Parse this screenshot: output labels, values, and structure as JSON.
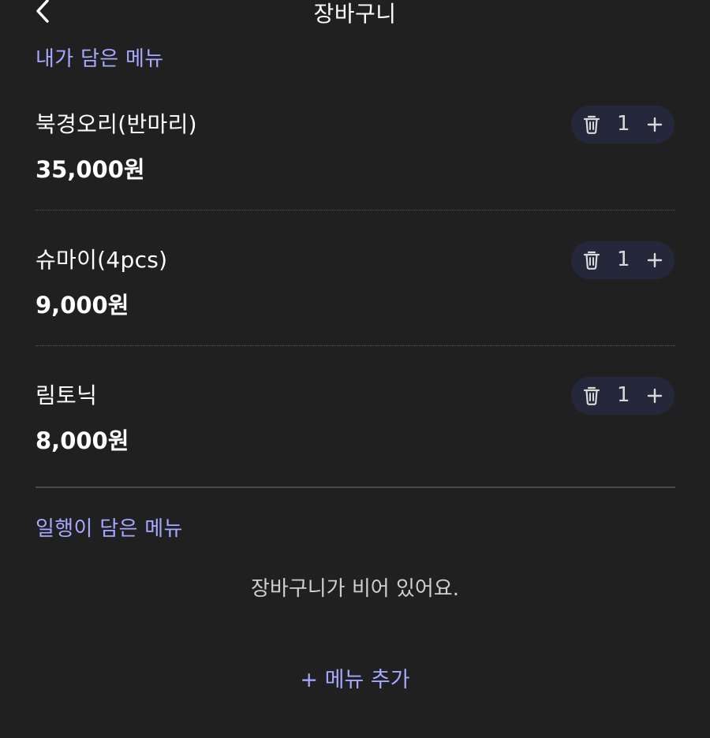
{
  "header": {
    "title": "장바구니",
    "back_icon": "chevron-left-icon"
  },
  "my_section": {
    "title": "내가 담은 메뉴",
    "items": [
      {
        "name": "북경오리(반마리)",
        "price": "35,000원",
        "quantity": "1"
      },
      {
        "name": "슈마이(4pcs)",
        "price": "9,000원",
        "quantity": "1"
      },
      {
        "name": "림토닉",
        "price": "8,000원",
        "quantity": "1"
      }
    ]
  },
  "group_section": {
    "title": "일행이 담은 메뉴",
    "empty_message": "장바구니가 비어 있어요."
  },
  "add_menu_label": "+ 메뉴 추가",
  "colors": {
    "background": "#202020",
    "accent": "#a6a9ff",
    "stepper_bg": "#25283a"
  }
}
